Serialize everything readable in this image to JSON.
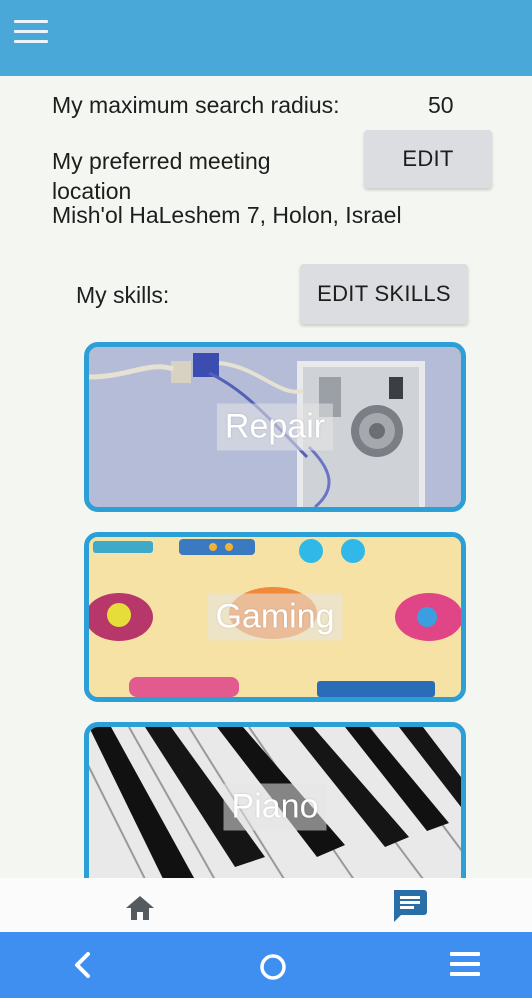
{
  "header": {
    "menu_icon": "hamburger-menu-icon",
    "background_color": "#4aa8d8"
  },
  "settings": {
    "radius_label": "My maximum search radius:",
    "radius_value": "50",
    "meeting_label": "My preferred meeting location",
    "edit_label": "EDIT",
    "meeting_address": "Mish'ol HaLeshem 7, Holon, Israel"
  },
  "skills": {
    "label": "My skills:",
    "edit_skills_label": "EDIT SKILLS",
    "items": [
      {
        "name": "Repair"
      },
      {
        "name": "Gaming"
      },
      {
        "name": "Piano"
      }
    ],
    "card_border_color": "#2c9fd6"
  },
  "bottom_nav": {
    "items": [
      {
        "icon": "home-icon"
      },
      {
        "icon": "chat-icon"
      }
    ]
  },
  "system_nav": {
    "background_color": "#3f8ff0",
    "items": [
      {
        "icon": "back-icon"
      },
      {
        "icon": "home-circle-icon"
      },
      {
        "icon": "menu-icon"
      }
    ]
  }
}
